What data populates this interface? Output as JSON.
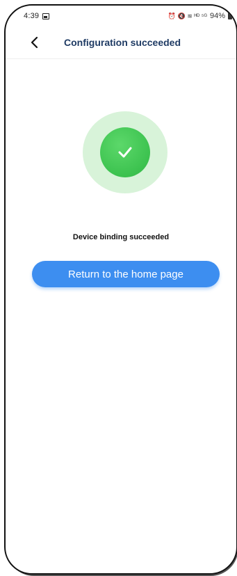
{
  "status_bar": {
    "time": "4:39",
    "signal_text": "⏰ 🔇 ≋ ᴴᴰ ⁵ᴳ",
    "battery": "94%"
  },
  "header": {
    "title": "Configuration succeeded",
    "back_icon": "chevron-left-icon"
  },
  "main": {
    "success_icon": "check-circle-icon",
    "message": "Device binding succeeded",
    "home_button_label": "Return to the home page"
  },
  "colors": {
    "accent": "#3d8ef0",
    "title": "#1f3b64",
    "success": "#3cc24f",
    "success_halo": "#d8f3d9"
  }
}
